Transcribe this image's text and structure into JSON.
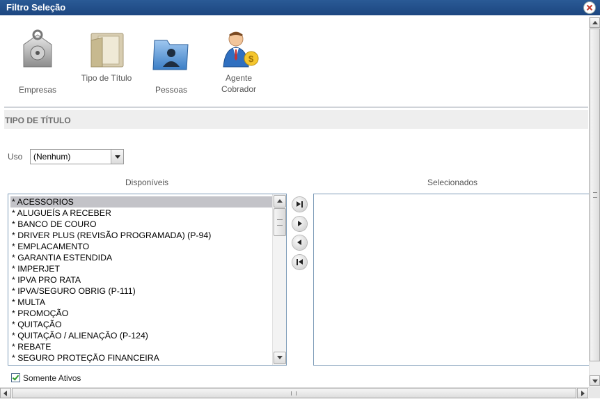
{
  "window": {
    "title": "Filtro Seleção",
    "close": "close"
  },
  "toolbar": {
    "items": [
      {
        "label": "Empresas",
        "icon": "safe-lock-icon"
      },
      {
        "label": "Tipo de Título",
        "icon": "folder-document-icon"
      },
      {
        "label": "Pessoas",
        "icon": "user-folder-icon"
      },
      {
        "label": "Agente Cobrador",
        "icon": "agent-money-icon"
      }
    ]
  },
  "section": {
    "title": "TIPO DE TÍTULO"
  },
  "uso": {
    "label": "Uso",
    "value": "(Nenhum)"
  },
  "available": {
    "heading": "Disponíveis",
    "items": [
      "* ACESSORIOS",
      "* ALUGUEÍS A RECEBER",
      "* BANCO DE COURO",
      "* DRIVER PLUS (REVISÃO PROGRAMADA) (P-94)",
      "* EMPLACAMENTO",
      "* GARANTIA ESTENDIDA",
      "* IMPERJET",
      "* IPVA PRO RATA",
      "* IPVA/SEGURO OBRIG (P-111)",
      "* MULTA",
      "* PROMOÇÃO",
      "* QUITAÇÃO",
      "* QUITAÇÃO / ALIENAÇÃO (P-124)",
      "* REBATE",
      "* SEGURO PROTEÇÃO FINANCEIRA"
    ],
    "selected_index": 0
  },
  "selected": {
    "heading": "Selecionados",
    "items": []
  },
  "only_active": {
    "label": "Somente Ativos",
    "checked": true
  }
}
